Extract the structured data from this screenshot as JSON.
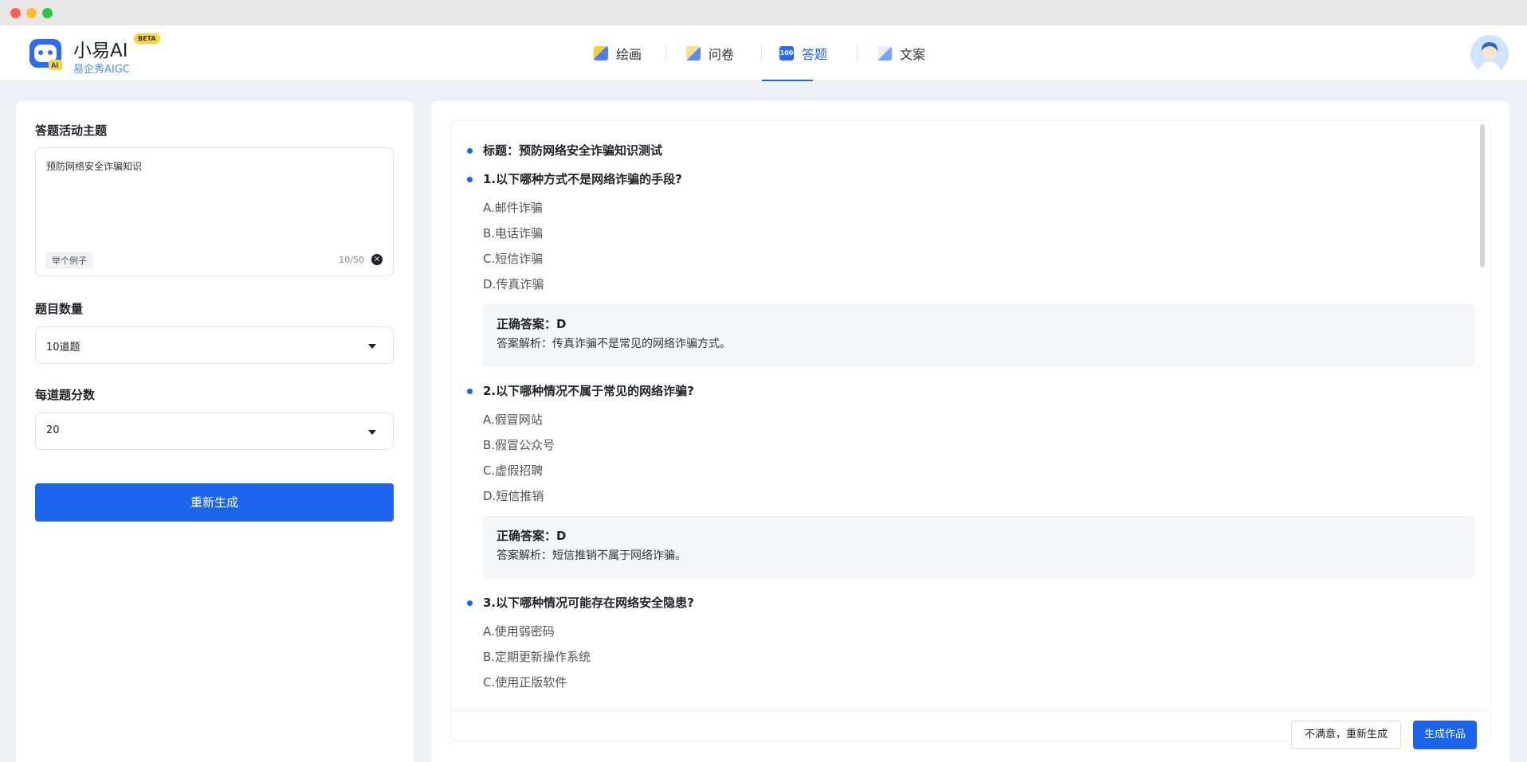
{
  "brand": {
    "name": "小易AI",
    "badge": "BETA",
    "subtitle": "易企秀AIGC"
  },
  "nav": {
    "tabs": [
      {
        "label": "绘画",
        "icon": "paint-icon"
      },
      {
        "label": "问卷",
        "icon": "survey-icon"
      },
      {
        "label": "答题",
        "icon": "quiz-icon",
        "active": true
      },
      {
        "label": "文案",
        "icon": "copywriting-icon"
      }
    ]
  },
  "form": {
    "topic_label": "答题活动主题",
    "topic_value": "预防网络安全诈骗知识",
    "example_chip": "举个例子",
    "counter": "10/50",
    "count_label": "题目数量",
    "count_value": "10道题",
    "score_label": "每道题分数",
    "score_value": "20",
    "regenerate_label": "重新生成"
  },
  "result": {
    "title": "标题：预防网络安全诈骗知识测试",
    "questions": [
      {
        "q": "1.以下哪种方式不是网络诈骗的手段?",
        "options": [
          "A.邮件诈骗",
          "B.电话诈骗",
          "C.短信诈骗",
          "D.传真诈骗"
        ],
        "answer": "正确答案：D",
        "explain": "答案解析：传真诈骗不是常见的网络诈骗方式。"
      },
      {
        "q": "2.以下哪种情况不属于常见的网络诈骗?",
        "options": [
          "A.假冒网站",
          "B.假冒公众号",
          "C.虚假招聘",
          "D.短信推销"
        ],
        "answer": "正确答案：D",
        "explain": "答案解析：短信推销不属于网络诈骗。"
      },
      {
        "q": "3.以下哪种情况可能存在网络安全隐患?",
        "options": [
          "A.使用弱密码",
          "B.定期更新操作系统",
          "C.使用正版软件"
        ]
      }
    ]
  },
  "actions": {
    "unsatisfied_label": "不满意，重新生成",
    "generate_label": "生成作品"
  },
  "colors": {
    "accent": "#1a64f0",
    "badge": "#ffd43b"
  }
}
